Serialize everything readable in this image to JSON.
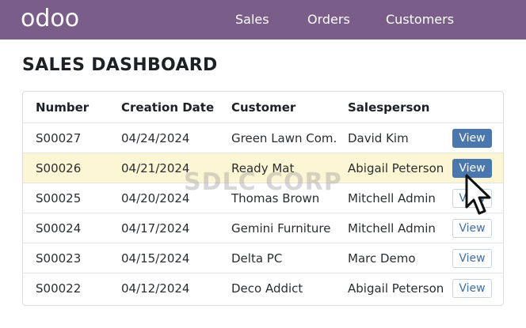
{
  "navbar": {
    "logo": "odoo",
    "items": [
      "Sales",
      "Orders",
      "Customers"
    ]
  },
  "page": {
    "title": "SALES DASHBOARD"
  },
  "table": {
    "columns": [
      "Number",
      "Creation Date",
      "Customer",
      "Salesperson"
    ],
    "rows": [
      {
        "number": "S00027",
        "date": "04/24/2024",
        "customer": "Green Lawn Com.",
        "salesperson": "David Kim",
        "action": "View"
      },
      {
        "number": "S00026",
        "date": "04/21/2024",
        "customer": "Ready Mat",
        "salesperson": "Abigail Peterson",
        "action": "View"
      },
      {
        "number": "S00025",
        "date": "04/20/2024",
        "customer": "Thomas Brown",
        "salesperson": "Mitchell Admin",
        "action": "View"
      },
      {
        "number": "S00024",
        "date": "04/17/2024",
        "customer": "Gemini Furniture",
        "salesperson": "Mitchell Admin",
        "action": "View"
      },
      {
        "number": "S00023",
        "date": "04/15/2024",
        "customer": "Delta PC",
        "salesperson": "Marc Demo",
        "action": "View"
      },
      {
        "number": "S00022",
        "date": "04/12/2024",
        "customer": "Deco Addict",
        "salesperson": "Abigail Peterson",
        "action": "View"
      }
    ]
  },
  "watermark": "SDLC CORP",
  "colors": {
    "navbar": "#7b5d8a",
    "primary_button": "#4a77ad",
    "highlight_row": "#fcf6d5"
  }
}
